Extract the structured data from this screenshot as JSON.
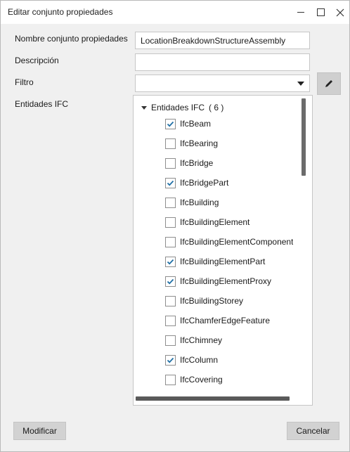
{
  "window": {
    "title": "Editar conjunto propiedades"
  },
  "form": {
    "name_label": "Nombre conjunto propiedades",
    "name_value": "LocationBreakdownStructureAssembly",
    "description_label": "Descripción",
    "description_value": "",
    "filter_label": "Filtro",
    "filter_value": "",
    "entities_label": "Entidades IFC"
  },
  "tree": {
    "root_label": "Entidades IFC",
    "root_count": "( 6 )",
    "items": [
      {
        "label": "IfcBeam",
        "checked": true
      },
      {
        "label": "IfcBearing",
        "checked": false
      },
      {
        "label": "IfcBridge",
        "checked": false
      },
      {
        "label": "IfcBridgePart",
        "checked": true
      },
      {
        "label": "IfcBuilding",
        "checked": false
      },
      {
        "label": "IfcBuildingElement",
        "checked": false
      },
      {
        "label": "IfcBuildingElementComponent",
        "checked": false
      },
      {
        "label": "IfcBuildingElementPart",
        "checked": true
      },
      {
        "label": "IfcBuildingElementProxy",
        "checked": true
      },
      {
        "label": "IfcBuildingStorey",
        "checked": false
      },
      {
        "label": "IfcChamferEdgeFeature",
        "checked": false
      },
      {
        "label": "IfcChimney",
        "checked": false
      },
      {
        "label": "IfcColumn",
        "checked": true
      },
      {
        "label": "IfcCovering",
        "checked": false
      }
    ]
  },
  "buttons": {
    "modify_label": "Modificar",
    "cancel_label": "Cancelar"
  },
  "colors": {
    "check": "#1f6fa5"
  },
  "icons": {
    "edit": "pencil-icon",
    "window_min": "minimize-icon",
    "window_max": "maximize-icon",
    "window_close": "close-icon"
  }
}
